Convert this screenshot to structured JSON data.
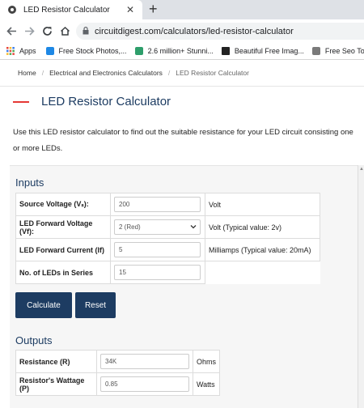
{
  "browser": {
    "tab_title": "LED Resistor Calculator",
    "tab_close": "✕",
    "new_tab": "+",
    "url": "circuitdigest.com/calculators/led-resistor-calculator",
    "bookmarks": [
      {
        "label": "Apps",
        "color": "#e8453c"
      },
      {
        "label": "Free Stock Photos,...",
        "color": "#1e88e5"
      },
      {
        "label": "2.6 million+ Stunni...",
        "color": "#2e9e6b"
      },
      {
        "label": "Beautiful Free Imag...",
        "color": "#222222"
      },
      {
        "label": "Free Seo Tools",
        "color": "#7a7a7a"
      }
    ]
  },
  "breadcrumb": {
    "home": "Home",
    "section": "Electrical and Electronics Calculators",
    "current": "LED Resistor Calculator"
  },
  "page": {
    "title": "LED Resistor Calculator",
    "intro_line1": "Use this LED resistor calculator to find out the suitable resistance for your LED circuit consisting one",
    "intro_line2": "or more LEDs."
  },
  "inputs": {
    "title": "Inputs",
    "source_voltage": {
      "label": "Source Voltage (Vₛ):",
      "value": "200",
      "unit": "Volt"
    },
    "forward_voltage": {
      "label": "LED Forward Voltage (Vf):",
      "value": "2 (Red)",
      "unit": "Volt (Typical value: 2v)"
    },
    "forward_current": {
      "label": "LED Forward Current (If)",
      "value": "5",
      "unit": "Milliamps (Typical value: 20mA)"
    },
    "led_count": {
      "label": "No. of LEDs in Series",
      "value": "15"
    }
  },
  "buttons": {
    "calculate": "Calculate",
    "reset": "Reset"
  },
  "outputs": {
    "title": "Outputs",
    "resistance": {
      "label": "Resistance (R)",
      "value": "34K",
      "unit": "Ohms"
    },
    "wattage": {
      "label": "Resistor's Wattage (P)",
      "value": "0.85",
      "unit": "Watts"
    }
  },
  "colors": {
    "brand_navy": "#1d3c62",
    "accent_red": "#e53935"
  }
}
